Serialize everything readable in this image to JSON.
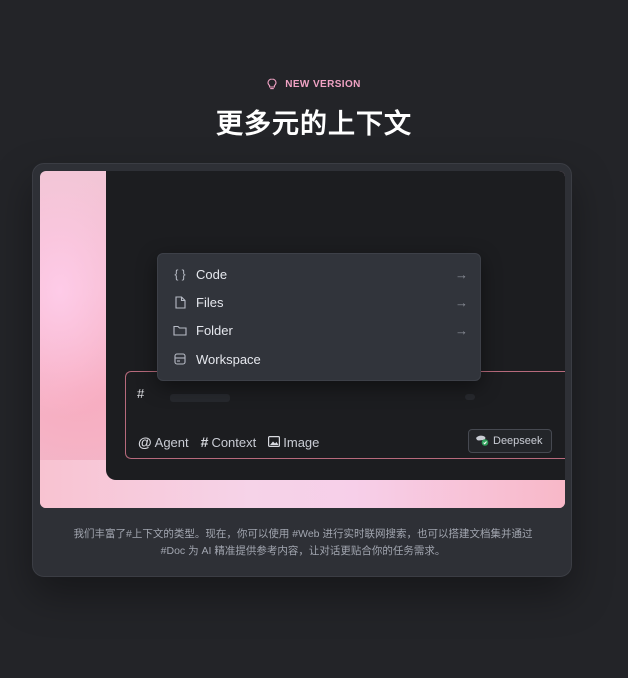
{
  "badge": {
    "label": "NEW VERSION",
    "icon": "lightbulb-icon"
  },
  "title": "更多元的上下文",
  "menu": {
    "items": [
      {
        "label": "Code",
        "icon": "braces-icon",
        "has_arrow": true
      },
      {
        "label": "Files",
        "icon": "file-icon",
        "has_arrow": true
      },
      {
        "label": "Folder",
        "icon": "folder-icon",
        "has_arrow": true
      },
      {
        "label": "Workspace",
        "icon": "workspace-icon",
        "has_arrow": false
      }
    ],
    "arrow_glyph": "→"
  },
  "input": {
    "value": "#",
    "chips": [
      {
        "symbol": "@",
        "label": "Agent"
      },
      {
        "symbol": "#",
        "label": "Context"
      },
      {
        "symbol": "▣",
        "label": "Image"
      }
    ],
    "model_label": "Deepseek"
  },
  "description": {
    "line1": "我们丰富了#上下文的类型。现在，你可以使用 #Web 进行实时联网搜索，也可以搭建文档集并通过",
    "line2": "#Doc 为 AI 精准提供参考内容，让对话更贴合你的任务需求。"
  },
  "colors": {
    "background": "#232428",
    "accent_pink": "#f0a2c4",
    "input_border": "#b76a7c"
  }
}
